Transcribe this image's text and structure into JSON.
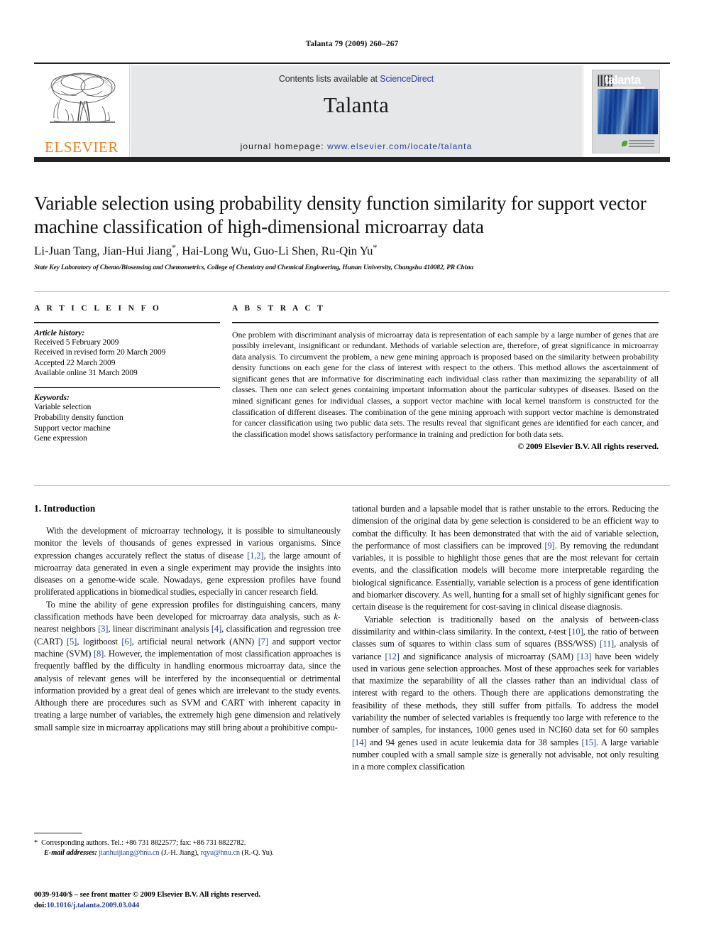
{
  "running_head": "Talanta 79 (2009) 260–267",
  "masthead": {
    "publisher_logo_text": "ELSEVIER",
    "contents_prefix": "Contents lists available at ",
    "contents_link": "ScienceDirect",
    "journal_name": "Talanta",
    "homepage_prefix": "journal homepage:",
    "homepage_url": "www.elsevier.com/locate/talanta",
    "cover_title": "talanta"
  },
  "article": {
    "title": "Variable selection using probability density function similarity for support vector machine classification of high-dimensional microarray data",
    "authors": "Li-Juan Tang, Jian-Hui Jiang*, Hai-Long Wu, Guo-Li Shen, Ru-Qin Yu*",
    "affiliation": "State Key Laboratory of Chemo/Biosensing and Chemometrics, College of Chemistry and Chemical Engineering, Hunan University, Changsha 410082, PR China"
  },
  "article_info": {
    "heading": "A R T I C L E   I N F O",
    "history_label": "Article history:",
    "history": [
      "Received 5 February 2009",
      "Received in revised form 20 March 2009",
      "Accepted 22 March 2009",
      "Available online 31 March 2009"
    ],
    "keywords_label": "Keywords:",
    "keywords": [
      "Variable selection",
      "Probability density function",
      "Support vector machine",
      "Gene expression"
    ]
  },
  "abstract": {
    "heading": "A B S T R A C T",
    "text": "One problem with discriminant analysis of microarray data is representation of each sample by a large number of genes that are possibly irrelevant, insignificant or redundant. Methods of variable selection are, therefore, of great significance in microarray data analysis. To circumvent the problem, a new gene mining approach is proposed based on the similarity between probability density functions on each gene for the class of interest with respect to the others. This method allows the ascertainment of significant genes that are informative for discriminating each individual class rather than maximizing the separability of all classes. Then one can select genes containing important information about the particular subtypes of diseases. Based on the mined significant genes for individual classes, a support vector machine with local kernel transform is constructed for the classification of different diseases. The combination of the gene mining approach with support vector machine is demonstrated for cancer classification using two public data sets. The results reveal that significant genes are identified for each cancer, and the classification model shows satisfactory performance in training and prediction for both data sets.",
    "copyright": "© 2009 Elsevier B.V. All rights reserved."
  },
  "body": {
    "section_heading": "1.  Introduction",
    "left_paragraphs": [
      {
        "parts": [
          {
            "t": "With the development of microarray technology, it is possible to simultaneously monitor the levels of thousands of genes expressed in various organisms. Since expression changes accurately reflect the status of disease "
          },
          {
            "t": "[1,2]",
            "ref": true
          },
          {
            "t": ", the large amount of microarray data generated in even a single experiment may provide the insights into diseases on a genome-wide scale. Nowadays, gene expression profiles have found proliferated applications in biomedical studies, especially in cancer research field."
          }
        ]
      },
      {
        "parts": [
          {
            "t": "To mine the ability of gene expression profiles for distinguishing cancers, many classification methods have been developed for microarray data analysis, such as "
          },
          {
            "t": "k",
            "italic": true
          },
          {
            "t": "-nearest neighbors "
          },
          {
            "t": "[3]",
            "ref": true
          },
          {
            "t": ", linear discriminant analysis "
          },
          {
            "t": "[4]",
            "ref": true
          },
          {
            "t": ", classification and regression tree (CART) "
          },
          {
            "t": "[5]",
            "ref": true
          },
          {
            "t": ", logitboost "
          },
          {
            "t": "[6]",
            "ref": true
          },
          {
            "t": ", artificial neural network (ANN) "
          },
          {
            "t": "[7]",
            "ref": true
          },
          {
            "t": " and support vector machine (SVM) "
          },
          {
            "t": "[8]",
            "ref": true
          },
          {
            "t": ". However, the implementation of most classification approaches is frequently baffled by the difficulty in handling enormous microarray data, since the analysis of relevant genes will be interfered by the inconsequential or detrimental information provided by a great deal of genes which are irrelevant to the study events. Although there are procedures such as SVM and CART with inherent capacity in treating a large number of variables, the extremely high gene dimension and relatively small sample size in microarray applications may still bring about a prohibitive compu-"
          }
        ]
      }
    ],
    "right_paragraphs": [
      {
        "continued": true,
        "parts": [
          {
            "t": "tational burden and a lapsable model that is rather unstable to the errors. Reducing the dimension of the original data by gene selection is considered to be an efficient way to combat the difficulty. It has been demonstrated that with the aid of variable selection, the performance of most classifiers can be improved "
          },
          {
            "t": "[9]",
            "ref": true
          },
          {
            "t": ". By removing the redundant variables, it is possible to highlight those genes that are the most relevant for certain events, and the classification models will become more interpretable regarding the biological significance. Essentially, variable selection is a process of gene identification and biomarker discovery. As well, hunting for a small set of highly significant genes for certain disease is the requirement for cost-saving in clinical disease diagnosis."
          }
        ]
      },
      {
        "parts": [
          {
            "t": "Variable selection is traditionally based on the analysis of between-class dissimilarity and within-class similarity. In the context, "
          },
          {
            "t": "t",
            "italic": true
          },
          {
            "t": "-test "
          },
          {
            "t": "[10]",
            "ref": true
          },
          {
            "t": ", the ratio of between classes sum of squares to within class sum of squares (BSS/WSS) "
          },
          {
            "t": "[11]",
            "ref": true
          },
          {
            "t": ", analysis of variance "
          },
          {
            "t": "[12]",
            "ref": true
          },
          {
            "t": " and significance analysis of microarray (SAM) "
          },
          {
            "t": "[13]",
            "ref": true
          },
          {
            "t": " have been widely used in various gene selection approaches. Most of these approaches seek for variables that maximize the separability of all the classes rather than an individual class of interest with regard to the others. Though there are applications demonstrating the feasibility of these methods, they still suffer from pitfalls. To address the model variability the number of selected variables is frequently too large with reference to the number of samples, for instances, 1000 genes used in NCI60 data set for 60 samples "
          },
          {
            "t": "[14]",
            "ref": true
          },
          {
            "t": " and 94 genes used in acute leukemia data for 38 samples "
          },
          {
            "t": "[15]",
            "ref": true
          },
          {
            "t": ". A large variable number coupled with a small sample size is generally not advisable, not only resulting in a more complex classification"
          }
        ]
      }
    ]
  },
  "footnotes": {
    "corresponding": "Corresponding authors. Tel.: +86 731 8822577; fax: +86 731 8822782.",
    "email_label": "E-mail addresses:",
    "email1": "jianhuijiang@hnu.cn",
    "email1_owner": "(J.-H. Jiang),",
    "email2": "rqyu@hnu.cn",
    "email2_owner": "(R.-Q. Yu).",
    "issn_line": "0039-9140/$ – see front matter © 2009 Elsevier B.V. All rights reserved.",
    "doi_label": "doi:",
    "doi_value": "10.1016/j.talanta.2009.03.044"
  },
  "colors": {
    "link": "#2b3f9e",
    "elsevier_orange": "#f07f1a",
    "band": "#e6e7e9",
    "rule": "#232323"
  }
}
